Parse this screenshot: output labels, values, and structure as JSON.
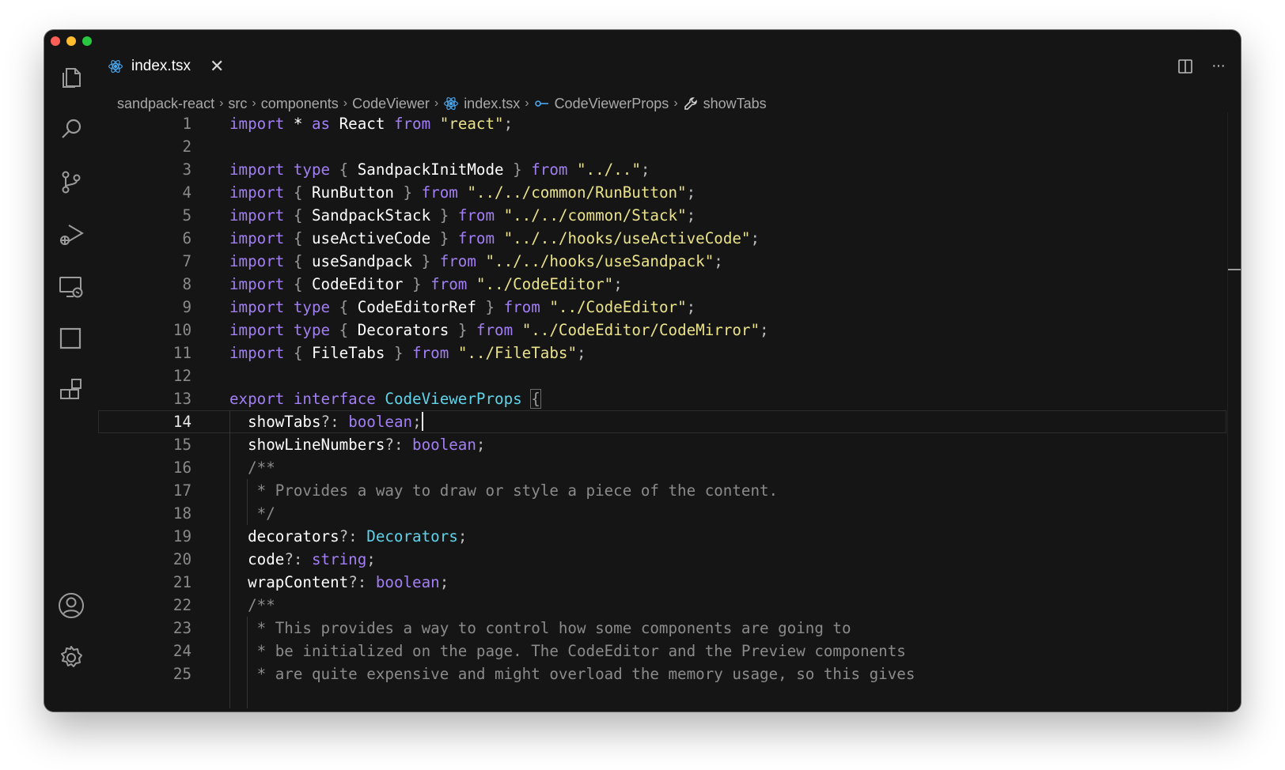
{
  "window": {
    "traffic_lights": [
      "#ff5f57",
      "#febc2e",
      "#28c840"
    ]
  },
  "activity_bar": {
    "top_icons": [
      "explorer-icon",
      "search-icon",
      "source-control-icon",
      "run-debug-icon",
      "remote-explorer-icon",
      "panel-icon",
      "extensions-icon"
    ],
    "bottom_icons": [
      "account-icon",
      "settings-gear-icon"
    ]
  },
  "tab": {
    "label": "index.tsx",
    "close_glyph": "✕",
    "icon": "react-icon"
  },
  "tab_actions": {
    "more_glyph": "···"
  },
  "breadcrumb": {
    "items": [
      "sandpack-react",
      "src",
      "components",
      "CodeViewer",
      "index.tsx",
      "CodeViewerProps",
      "showTabs"
    ],
    "separator": "›"
  },
  "editor": {
    "cursor_line": 14,
    "colors": {
      "keyword": "#a27ff5",
      "string": "#eae38a",
      "type": "#5fd3ea",
      "comment": "#8b8b8b",
      "background": "#151515"
    },
    "lines": [
      [
        [
          "kw",
          "import"
        ],
        [
          "id",
          " * "
        ],
        [
          "kw",
          "as"
        ],
        [
          "id",
          " React "
        ],
        [
          "kw",
          "from"
        ],
        [
          "str",
          " \"react\""
        ],
        [
          "punc",
          ";"
        ]
      ],
      [],
      [
        [
          "kw",
          "import"
        ],
        [
          "kw",
          " type"
        ],
        [
          "brace",
          " { "
        ],
        [
          "id",
          "SandpackInitMode"
        ],
        [
          "brace",
          " } "
        ],
        [
          "kw",
          "from"
        ],
        [
          "str",
          " \"../..\""
        ],
        [
          "punc",
          ";"
        ]
      ],
      [
        [
          "kw",
          "import"
        ],
        [
          "brace",
          " { "
        ],
        [
          "id",
          "RunButton"
        ],
        [
          "brace",
          " } "
        ],
        [
          "kw",
          "from"
        ],
        [
          "str",
          " \"../../common/RunButton\""
        ],
        [
          "punc",
          ";"
        ]
      ],
      [
        [
          "kw",
          "import"
        ],
        [
          "brace",
          " { "
        ],
        [
          "id",
          "SandpackStack"
        ],
        [
          "brace",
          " } "
        ],
        [
          "kw",
          "from"
        ],
        [
          "str",
          " \"../../common/Stack\""
        ],
        [
          "punc",
          ";"
        ]
      ],
      [
        [
          "kw",
          "import"
        ],
        [
          "brace",
          " { "
        ],
        [
          "id",
          "useActiveCode"
        ],
        [
          "brace",
          " } "
        ],
        [
          "kw",
          "from"
        ],
        [
          "str",
          " \"../../hooks/useActiveCode\""
        ],
        [
          "punc",
          ";"
        ]
      ],
      [
        [
          "kw",
          "import"
        ],
        [
          "brace",
          " { "
        ],
        [
          "id",
          "useSandpack"
        ],
        [
          "brace",
          " } "
        ],
        [
          "kw",
          "from"
        ],
        [
          "str",
          " \"../../hooks/useSandpack\""
        ],
        [
          "punc",
          ";"
        ]
      ],
      [
        [
          "kw",
          "import"
        ],
        [
          "brace",
          " { "
        ],
        [
          "id",
          "CodeEditor"
        ],
        [
          "brace",
          " } "
        ],
        [
          "kw",
          "from"
        ],
        [
          "str",
          " \"../CodeEditor\""
        ],
        [
          "punc",
          ";"
        ]
      ],
      [
        [
          "kw",
          "import"
        ],
        [
          "kw",
          " type"
        ],
        [
          "brace",
          " { "
        ],
        [
          "id",
          "CodeEditorRef"
        ],
        [
          "brace",
          " } "
        ],
        [
          "kw",
          "from"
        ],
        [
          "str",
          " \"../CodeEditor\""
        ],
        [
          "punc",
          ";"
        ]
      ],
      [
        [
          "kw",
          "import"
        ],
        [
          "kw",
          " type"
        ],
        [
          "brace",
          " { "
        ],
        [
          "id",
          "Decorators"
        ],
        [
          "brace",
          " } "
        ],
        [
          "kw",
          "from"
        ],
        [
          "str",
          " \"../CodeEditor/CodeMirror\""
        ],
        [
          "punc",
          ";"
        ]
      ],
      [
        [
          "kw",
          "import"
        ],
        [
          "brace",
          " { "
        ],
        [
          "id",
          "FileTabs"
        ],
        [
          "brace",
          " } "
        ],
        [
          "kw",
          "from"
        ],
        [
          "str",
          " \"../FileTabs\""
        ],
        [
          "punc",
          ";"
        ]
      ],
      [],
      [
        [
          "kw",
          "export"
        ],
        [
          "kw",
          " interface"
        ],
        [
          "type",
          " CodeViewerProps"
        ],
        [
          "id",
          " "
        ],
        [
          "bracketbox",
          "{"
        ]
      ],
      [
        [
          "prop",
          "  showTabs"
        ],
        [
          "punc",
          "?: "
        ],
        [
          "kw",
          "boolean"
        ],
        [
          "punc",
          ";"
        ],
        [
          "cursor",
          ""
        ]
      ],
      [
        [
          "prop",
          "  showLineNumbers"
        ],
        [
          "punc",
          "?: "
        ],
        [
          "kw",
          "boolean"
        ],
        [
          "punc",
          ";"
        ]
      ],
      [
        [
          "cmt",
          "  /**"
        ]
      ],
      [
        [
          "cmt",
          "   * Provides a way to draw or style a piece of the content."
        ]
      ],
      [
        [
          "cmt",
          "   */"
        ]
      ],
      [
        [
          "prop",
          "  decorators"
        ],
        [
          "punc",
          "?: "
        ],
        [
          "type2",
          "Decorators"
        ],
        [
          "punc",
          ";"
        ]
      ],
      [
        [
          "prop",
          "  code"
        ],
        [
          "punc",
          "?: "
        ],
        [
          "kw",
          "string"
        ],
        [
          "punc",
          ";"
        ]
      ],
      [
        [
          "prop",
          "  wrapContent"
        ],
        [
          "punc",
          "?: "
        ],
        [
          "kw",
          "boolean"
        ],
        [
          "punc",
          ";"
        ]
      ],
      [
        [
          "cmt",
          "  /**"
        ]
      ],
      [
        [
          "cmt",
          "   * This provides a way to control how some components are going to"
        ]
      ],
      [
        [
          "cmt",
          "   * be initialized on the page. The CodeEditor and the Preview components"
        ]
      ],
      [
        [
          "cmt",
          "   * are quite expensive and might overload the memory usage, so this gives"
        ]
      ]
    ]
  }
}
